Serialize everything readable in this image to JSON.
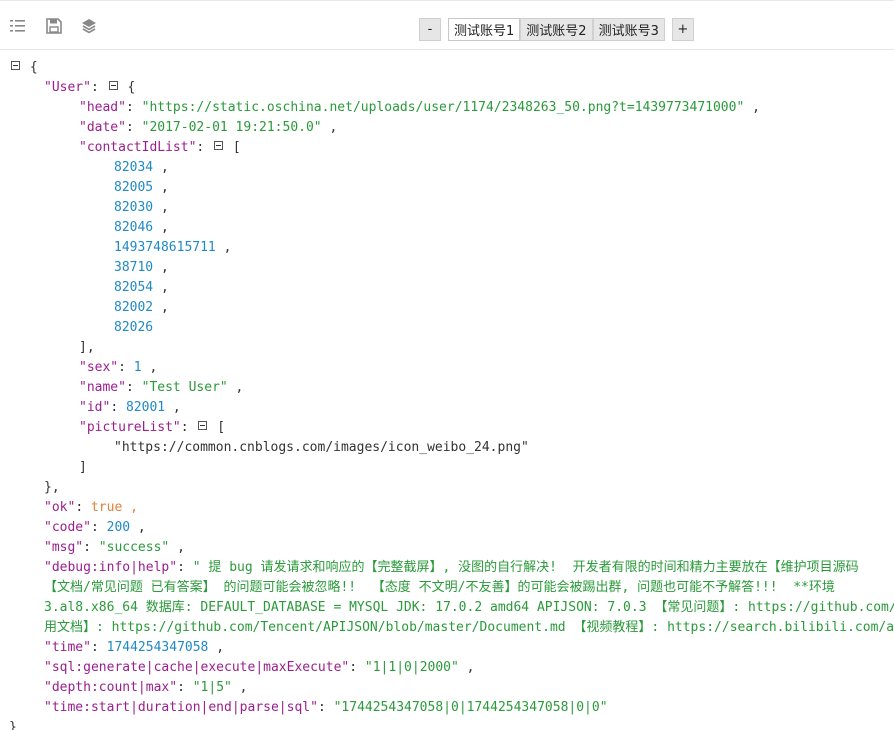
{
  "toolbar": {
    "icons": [
      "line-number-icon",
      "save-icon",
      "layers-icon"
    ],
    "minus_label": "-",
    "plus_label": "+",
    "tabs": [
      {
        "label": "测试账号1",
        "active": true
      },
      {
        "label": "测试账号2",
        "active": false
      },
      {
        "label": "测试账号3",
        "active": false
      }
    ]
  },
  "json": {
    "user_key": "\"User\"",
    "head_key": "\"head\"",
    "head_val": "\"https://static.oschina.net/uploads/user/1174/2348263_50.png?t=1439773471000\"",
    "date_key": "\"date\"",
    "date_val": "\"2017-02-01 19:21:50.0\"",
    "contact_key": "\"contactIdList\"",
    "contact_ids": [
      "82034",
      "82005",
      "82030",
      "82046",
      "1493748615711",
      "38710",
      "82054",
      "82002",
      "82026"
    ],
    "sex_key": "\"sex\"",
    "sex_val": "1",
    "name_key": "\"name\"",
    "name_val": "\"Test User\"",
    "id_key": "\"id\"",
    "id_val": "82001",
    "picture_key": "\"pictureList\"",
    "picture_val": "\"https://common.cnblogs.com/images/icon_weibo_24.png\"",
    "ok_key": "\"ok\"",
    "ok_val": "true",
    "code_key": "\"code\"",
    "code_val": "200",
    "msg_key": "\"msg\"",
    "msg_val": "\"success\"",
    "debug_key": "\"debug:info|help\"",
    "debug_line1": "\" 提 bug 请发请求和响应的【完整截屏】, 没图的自行解决!  开发者有限的时间和精力主要放在【维护项目源码",
    "debug_line2": "【文档/常见问题 已有答案】 的问题可能会被忽略!!  【态度 不文明/不友善】的可能会被踢出群, 问题也可能不予解答!!!  **环境",
    "debug_line3": "3.al8.x86_64 数据库: DEFAULT_DATABASE = MYSQL JDK: 17.0.2 amd64 APIJSON: 7.0.3 【常见问题】: https://github.com/",
    "debug_line4": "用文档】: https://github.com/Tencent/APIJSON/blob/master/Document.md 【视频教程】: https://search.bilibili.com/al",
    "time_key": "\"time\"",
    "time_val": "1744254347058",
    "sql_key": "\"sql:generate|cache|execute|maxExecute\"",
    "sql_val": "\"1|1|0|2000\"",
    "depth_key": "\"depth:count|max\"",
    "depth_val": "\"1|5\"",
    "timing_key": "\"time:start|duration|end|parse|sql\"",
    "timing_val": "\"1744254347058|0|1744254347058|0|0\""
  },
  "colors": {
    "key": "#9b1e8e",
    "string": "#2a9a3a",
    "number": "#1f89c7",
    "boolean": "#e0813c"
  }
}
